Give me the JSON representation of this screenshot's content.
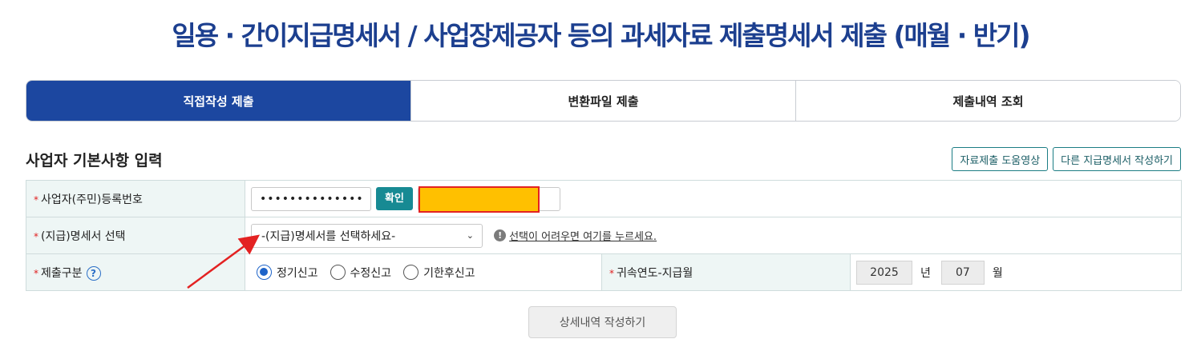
{
  "title": "일용 · 간이지급명세서 / 사업장제공자 등의 과세자료 제출명세서 제출 (매월 · 반기)",
  "tabs": [
    {
      "label": "직접작성 제출",
      "active": true
    },
    {
      "label": "변환파일 제출",
      "active": false
    },
    {
      "label": "제출내역 조회",
      "active": false
    }
  ],
  "section": {
    "title": "사업자 기본사항 입력",
    "buttons": [
      "자료제출 도움영상",
      "다른 지급명세서 작성하기"
    ]
  },
  "form": {
    "required_mark": "*",
    "reg_number": {
      "label": "사업자(주민)등록번호",
      "value": "••••••••••••••",
      "confirm_label": "확인"
    },
    "statement_select": {
      "label": "(지급)명세서 선택",
      "selected": "-(지급)명세서를 선택하세요-",
      "help_text": "선택이 어려우면 여기를 누르세요."
    },
    "submission_type": {
      "label": "제출구분",
      "options": [
        {
          "label": "정기신고",
          "checked": true
        },
        {
          "label": "수정신고",
          "checked": false
        },
        {
          "label": "기한후신고",
          "checked": false
        }
      ]
    },
    "period": {
      "label": "귀속연도-지급월",
      "year": "2025",
      "year_unit": "년",
      "month": "07",
      "month_unit": "월"
    }
  },
  "detail_button": "상세내역 작성하기",
  "colors": {
    "title": "#1c3f8f",
    "active_tab": "#1c47a0",
    "label_bg": "#eef6f5",
    "confirm_button": "#178a93",
    "redaction": "#ffc000",
    "highlight_red": "#e32222"
  }
}
